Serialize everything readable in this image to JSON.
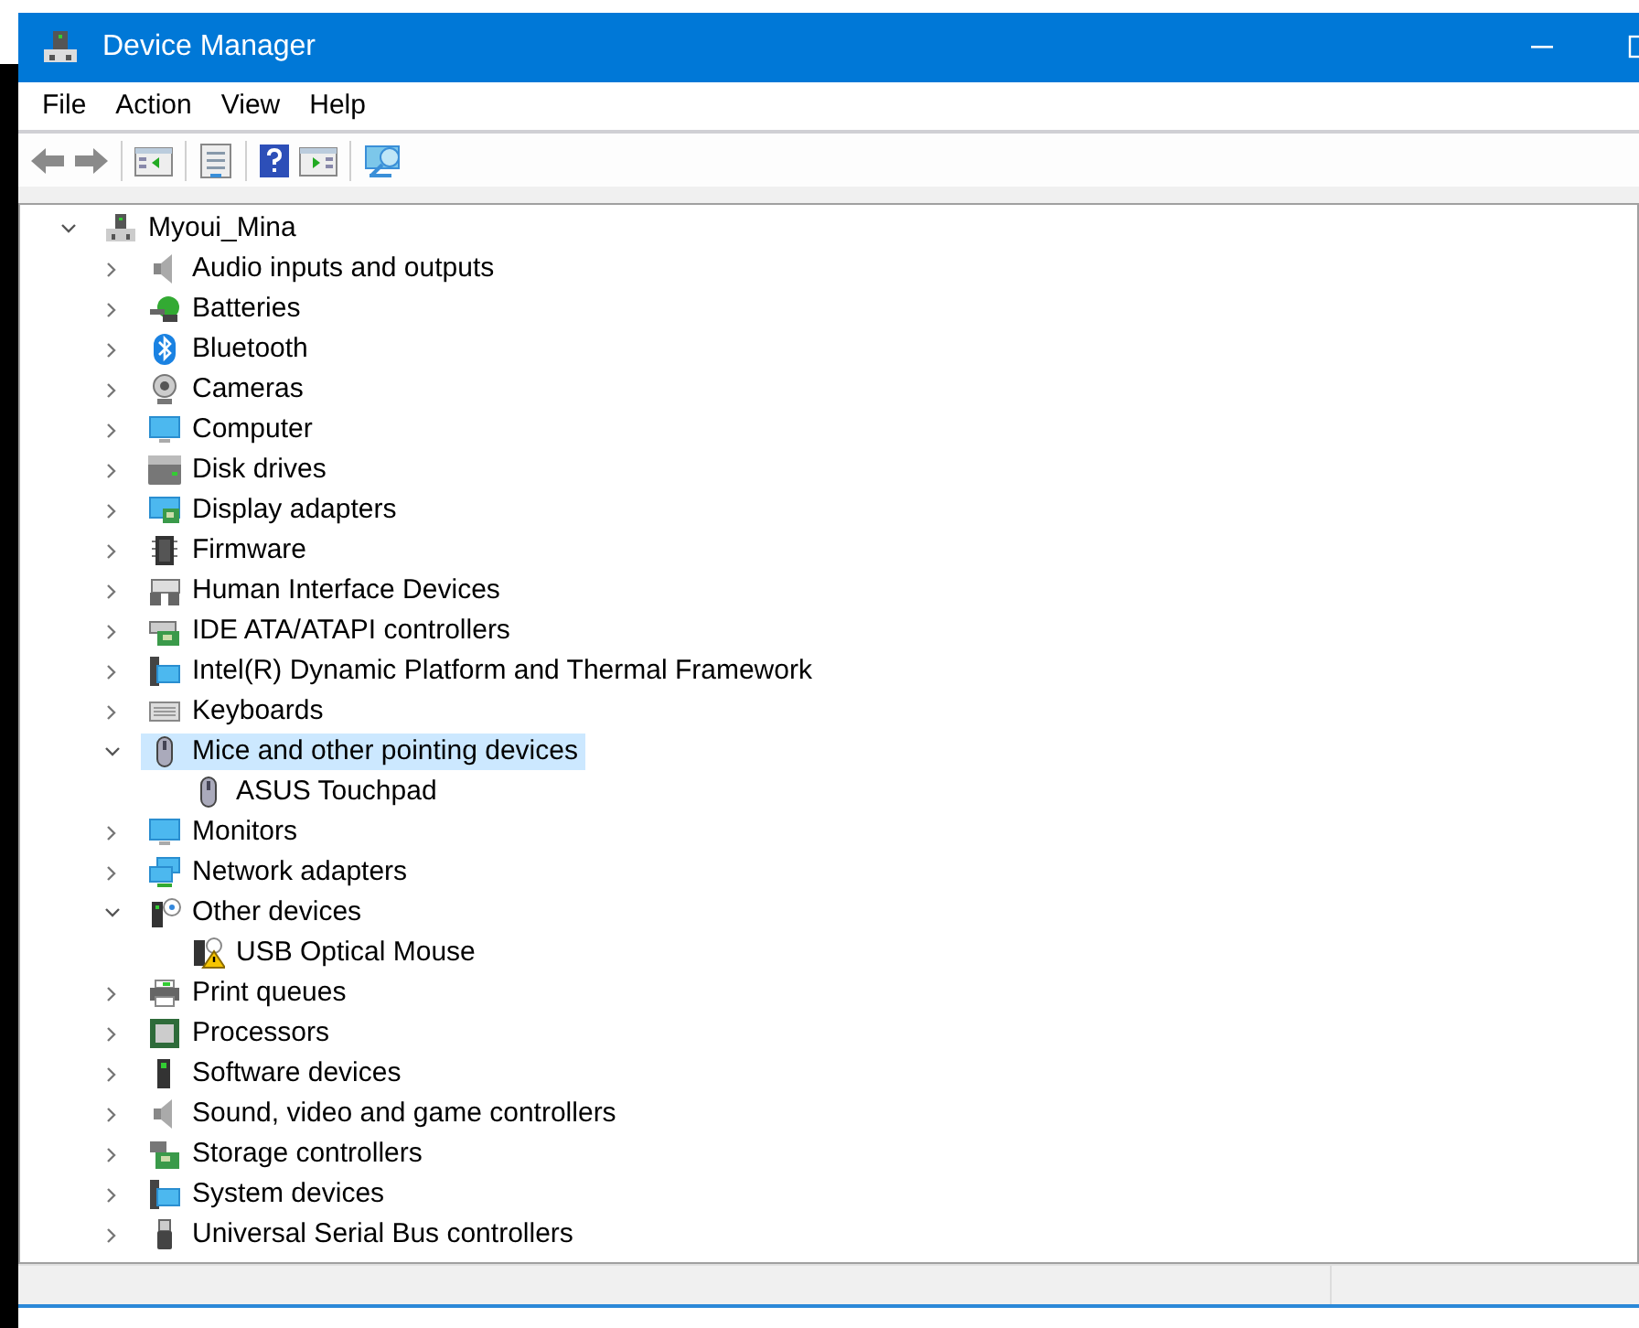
{
  "window": {
    "title": "Device Manager"
  },
  "menu": [
    "File",
    "Action",
    "View",
    "Help"
  ],
  "tree": {
    "label": "Myoui_Mina",
    "expanded": true,
    "selected": false,
    "children": [
      {
        "label": "Audio inputs and outputs",
        "expanded": false,
        "selected": false
      },
      {
        "label": "Batteries",
        "expanded": false,
        "selected": false
      },
      {
        "label": "Bluetooth",
        "expanded": false,
        "selected": false
      },
      {
        "label": "Cameras",
        "expanded": false,
        "selected": false
      },
      {
        "label": "Computer",
        "expanded": false,
        "selected": false
      },
      {
        "label": "Disk drives",
        "expanded": false,
        "selected": false
      },
      {
        "label": "Display adapters",
        "expanded": false,
        "selected": false
      },
      {
        "label": "Firmware",
        "expanded": false,
        "selected": false
      },
      {
        "label": "Human Interface Devices",
        "expanded": false,
        "selected": false
      },
      {
        "label": "IDE ATA/ATAPI controllers",
        "expanded": false,
        "selected": false
      },
      {
        "label": "Intel(R) Dynamic Platform and Thermal Framework",
        "expanded": false,
        "selected": false
      },
      {
        "label": "Keyboards",
        "expanded": false,
        "selected": false
      },
      {
        "label": "Mice and other pointing devices",
        "expanded": true,
        "selected": true,
        "children": [
          {
            "label": "ASUS Touchpad",
            "selected": false
          }
        ]
      },
      {
        "label": "Monitors",
        "expanded": false,
        "selected": false
      },
      {
        "label": "Network adapters",
        "expanded": false,
        "selected": false
      },
      {
        "label": "Other devices",
        "expanded": true,
        "selected": false,
        "children": [
          {
            "label": "USB Optical Mouse",
            "selected": false
          }
        ]
      },
      {
        "label": "Print queues",
        "expanded": false,
        "selected": false
      },
      {
        "label": "Processors",
        "expanded": false,
        "selected": false
      },
      {
        "label": "Software devices",
        "expanded": false,
        "selected": false
      },
      {
        "label": "Sound, video and game controllers",
        "expanded": false,
        "selected": false
      },
      {
        "label": "Storage controllers",
        "expanded": false,
        "selected": false
      },
      {
        "label": "System devices",
        "expanded": false,
        "selected": false
      },
      {
        "label": "Universal Serial Bus controllers",
        "expanded": false,
        "selected": false
      }
    ]
  }
}
